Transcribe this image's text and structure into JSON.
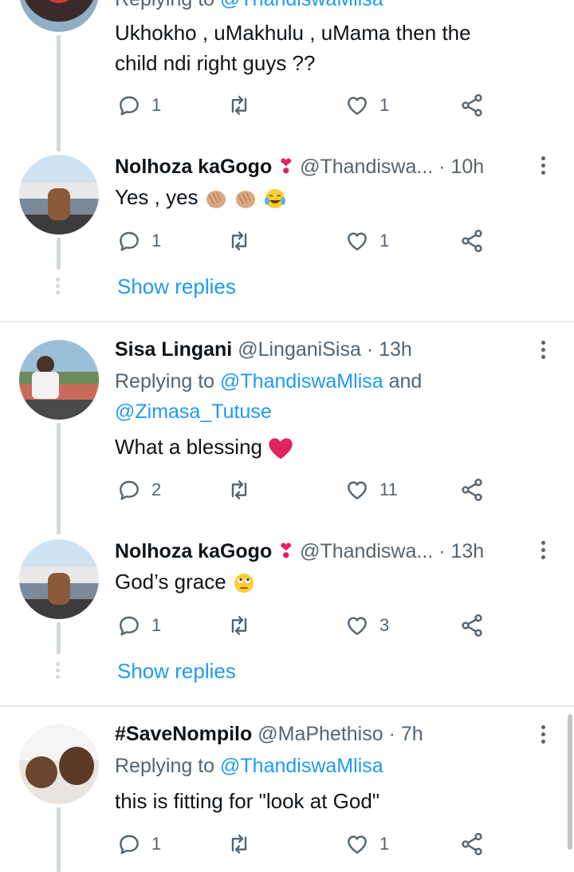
{
  "colors": {
    "accent": "#1d9bf0",
    "muted": "#536471",
    "heart": "#e0245e",
    "thread": "#cfd9de"
  },
  "top_tweet": {
    "replying_prefix": "Replying to",
    "replying_handle": "@ThandiswaMlisa",
    "text": "Ukhokho , uMakhulu , uMama then the child ndi right guys ??",
    "line1": "Ukhokho , uMakhulu , uMama then the",
    "line2": "child ndi right guys ??",
    "replies": "1",
    "retweets": "",
    "likes": "1"
  },
  "reply1": {
    "name": "Nolhoza kaGogo",
    "name_emoji": "❣",
    "handle": "@Thandiswa...",
    "time": "· 10h",
    "text": "Yes , yes",
    "emojis": [
      "clapping-hands",
      "clapping-hands",
      "tears-of-joy"
    ],
    "replies": "1",
    "likes": "1",
    "show_replies": "Show replies"
  },
  "tweet2": {
    "name": "Sisa Lingani",
    "handle": "@LinganiSisa",
    "time": "· 13h",
    "replying_prefix": "Replying to",
    "replying_handle1": "@ThandiswaMlisa",
    "replying_and": "and",
    "replying_handle2": "@Zimasa_Tutuse",
    "text": "What a blessing",
    "emoji": "red-heart",
    "replies": "2",
    "likes": "11"
  },
  "reply2": {
    "name": "Nolhoza kaGogo",
    "name_emoji": "❣",
    "handle": "@Thandiswa...",
    "time": "· 13h",
    "text": "God’s grace",
    "emoji": "face-with-rolling-eyes",
    "replies": "1",
    "likes": "3",
    "show_replies": "Show replies"
  },
  "tweet3": {
    "name": "#SaveNompilo",
    "handle": "@MaPhethiso",
    "time": "· 7h",
    "replying_prefix": "Replying to",
    "replying_handle": "@ThandiswaMlisa",
    "text": "this is fitting for \"look at God\"",
    "replies": "1",
    "likes": "1"
  },
  "icons": {
    "reply": "reply-icon",
    "retweet": "retweet-icon",
    "like": "heart-icon",
    "share": "share-icon",
    "more": "more-vertical-icon"
  }
}
